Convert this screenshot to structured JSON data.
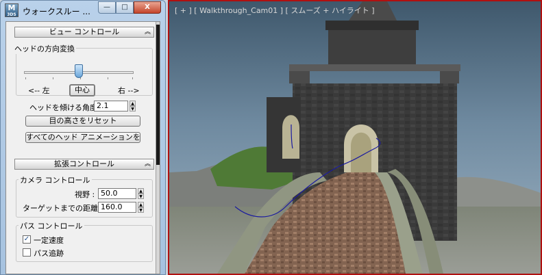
{
  "window": {
    "title": "ウォークスルー ...",
    "app_icon_line1": "M",
    "app_icon_line2": "3DS",
    "minimize": "—",
    "maximize": "□",
    "close": "X"
  },
  "view_control": {
    "title": "ビュー コントロール",
    "group_label": "ヘッドの方向変換",
    "slider_value": 0.5,
    "left_label": "<-- 左",
    "center_label": "中心",
    "right_label": "右 -->",
    "tilt_label": "ヘッドを傾ける角度",
    "tilt_value": "2.1",
    "reset_eye_label": "目の高さをリセット",
    "delete_anim_label": "すべてのヘッド アニメーションを削除"
  },
  "advanced_control": {
    "title": "拡張コントロール",
    "camera_group": "カメラ コントロール",
    "fov_label": "視野 :",
    "fov_value": "50.0",
    "target_label": "ターゲットまでの距離 :",
    "target_value": "160.0",
    "path_group": "パス コントロール",
    "constant_speed_label": "一定速度",
    "constant_speed_checked": true,
    "follow_path_label": "パス追跡",
    "follow_path_checked": false
  },
  "viewport": {
    "label": "[ + ] [ Walkthrough_Cam01 ] [ スムーズ + ハイライト ]"
  },
  "colors": {
    "viewport_border": "#b01010",
    "path_line": "#1a1aa0",
    "sky": "#6f8aa0"
  }
}
